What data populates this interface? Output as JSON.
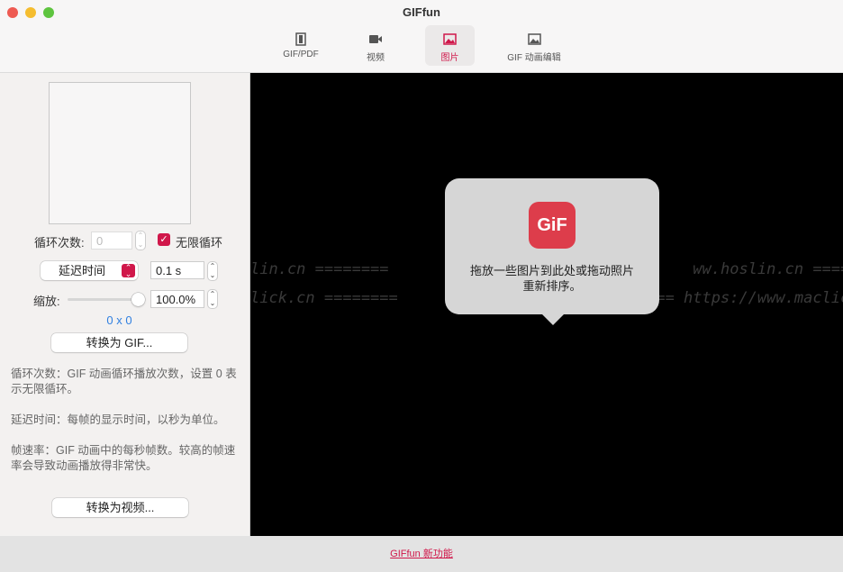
{
  "window": {
    "title": "GIFfun"
  },
  "tabs": [
    {
      "label": "GIF/PDF",
      "icon": "document-icon"
    },
    {
      "label": "视频",
      "icon": "video-camera-icon"
    },
    {
      "label": "图片",
      "icon": "image-icon",
      "active": true
    },
    {
      "label": "GIF 动画编辑",
      "icon": "image-edit-icon"
    }
  ],
  "controls": {
    "loop_label": "循环次数:",
    "loop_value": "0",
    "infinite_label": "无限循环",
    "infinite_checked": true,
    "delay_select": "延迟时间",
    "delay_value": "0.1 s",
    "scale_label": "缩放:",
    "scale_value": "100.0%",
    "scale_slider_percent": 100,
    "dimensions": "0 x 0",
    "convert_gif": "转换为 GIF...",
    "convert_video": "转换为视频..."
  },
  "descriptions": [
    "循环次数：GIF 动画循环播放次数，设置 0 表示无限循环。",
    "延迟时间：每帧的显示时间，以秒为单位。",
    "帧速率：GIF 动画中的每秒帧数。较高的帧速率会导致动画播放得非常快。"
  ],
  "drop": {
    "icon_text": "GiF",
    "message_line1": "拖放一些图片到此处或拖动照片",
    "message_line2": "重新排序。"
  },
  "watermark": {
    "line1": "lin.cn ========          ww.hoslin.cn ========",
    "line2": "lick.cn ========     ======== https://www.maclick.cn ========"
  },
  "footer": {
    "link": "GIFfun 新功能"
  },
  "colors": {
    "accent": "#d0174a",
    "icon_bg": "#dd3d4b"
  }
}
